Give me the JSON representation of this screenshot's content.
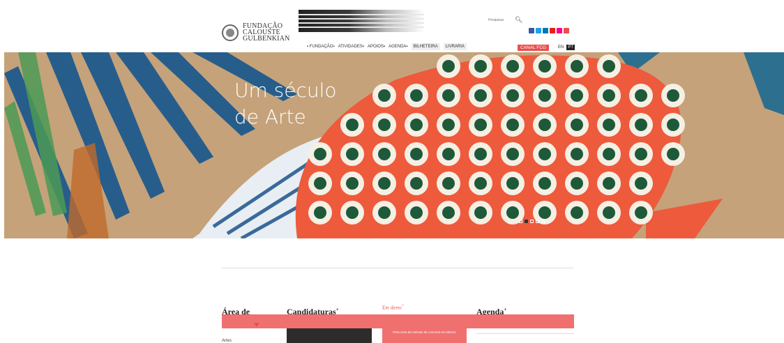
{
  "header": {
    "logo_lines": [
      "FUNDAÇÃO",
      "CALOUSTE",
      "GULBENKIAN"
    ],
    "nav": [
      {
        "label": "▪ FUNDAÇÃO▪"
      },
      {
        "label": "ATIVIDADES▪"
      },
      {
        "label": "APOIOS▪"
      },
      {
        "label": "AGENDA▪"
      },
      {
        "label": "BILHETEIRA"
      },
      {
        "label": "LIVRARIA"
      }
    ],
    "search_placeholder": "Pesquisar",
    "search_icon": "search-icon",
    "social": [
      {
        "name": "facebook-icon",
        "color": "#3b5998"
      },
      {
        "name": "twitter-icon",
        "color": "#1da1f2"
      },
      {
        "name": "linkedin-icon",
        "color": "#0077b5"
      },
      {
        "name": "youtube-icon",
        "color": "#e62117"
      },
      {
        "name": "flickr-icon",
        "color": "#ff0084"
      },
      {
        "name": "rss-icon",
        "color": "#e84f4f"
      }
    ],
    "canal": "CANAL FCG",
    "lang_en": "EN",
    "lang_pt": "PT"
  },
  "hero": {
    "title_line1": "Um século",
    "title_line2": "de Arte",
    "slides": 5,
    "active_slide": 2
  },
  "sections": {
    "area": "Área de",
    "candidaturas": "Candidaturas",
    "em_direto": "Em direto",
    "agenda": "Agenda",
    "artes": "Artes",
    "em_direto_box": "Para cima de notícias de concerto em directo"
  },
  "colors": {
    "accent": "#e84f4f",
    "hero_bg": "#c5a27a"
  }
}
